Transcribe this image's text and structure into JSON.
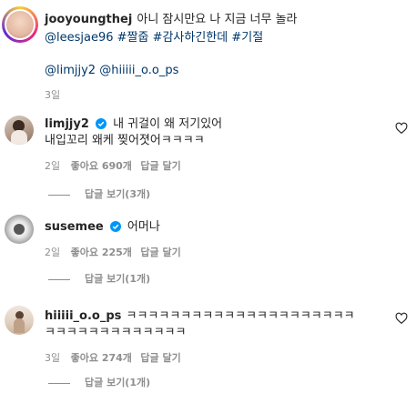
{
  "caption": {
    "username": "jooyoungthej",
    "text_line1": "아니 잠시만요 나 지금 너무 놀라",
    "hashtags_line": "@leesjae96 #짤줍 #감사하긴한데 #기절",
    "mentions_line": "@limjjy2 @hiiiii_o.o_ps",
    "time": "3일"
  },
  "comments": [
    {
      "username": "limjjy2",
      "verified": true,
      "text_line1": "내 귀걸이 왜 저기있어",
      "text_line2": "내입꼬리 왜케 찢어졋어ㅋㅋㅋㅋ",
      "time": "2일",
      "likes": "좋아요 690개",
      "reply": "답글 달기",
      "view_replies": "답글 보기(3개)"
    },
    {
      "username": "susemee",
      "verified": true,
      "text_line1": "어머나",
      "time": "2일",
      "likes": "좋아요 225개",
      "reply": "답글 달기",
      "view_replies": "답글 보기(1개)"
    },
    {
      "username": "hiiiii_o.o_ps",
      "verified": false,
      "text_line1": "ㅋㅋㅋㅋㅋㅋㅋㅋㅋㅋㅋㅋㅋㅋㅋㅋㅋㅋㅋㅋㅋ",
      "text_line2": "ㅋㅋㅋㅋㅋㅋㅋㅋㅋㅋㅋㅋㅋ",
      "time": "3일",
      "likes": "좋아요 274개",
      "reply": "답글 달기",
      "view_replies": "답글 보기(1개)"
    }
  ],
  "colors": {
    "verified_blue": "#0095f6",
    "link": "#00376b",
    "secondary": "#8e8e8e"
  }
}
